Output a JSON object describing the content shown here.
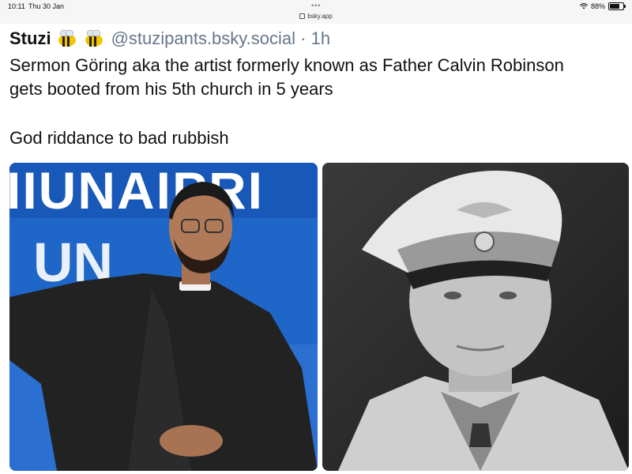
{
  "status_bar": {
    "time": "10:11",
    "date": "Thu 30 Jan",
    "battery": "88%",
    "battery_level": 0.88
  },
  "browser": {
    "url": "bsky.app",
    "menu": "•••"
  },
  "post": {
    "author_name": "Stuzi",
    "author_emoji": "bee-emoji x2",
    "handle": "@stuzipants.bsky.social",
    "separator": "·",
    "time_ago": "1h",
    "text_line1": "Sermon Göring aka the artist formerly known as Father Calvin Robinson",
    "text_line2": "gets booted from his 5th church in 5 years",
    "text_line3": "God riddance to bad rubbish"
  },
  "images": {
    "left_banner_text": "IIUNAIPRI",
    "left_banner_text_2": "UN",
    "colors": {
      "left_bg": "#1f66c9",
      "right_bg": "#2a2a2a"
    }
  }
}
